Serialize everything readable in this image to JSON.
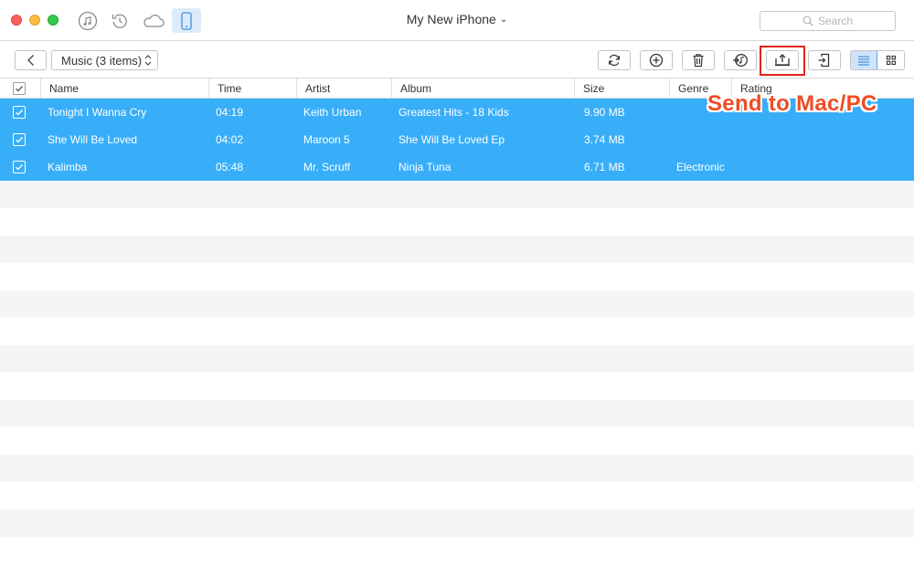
{
  "window": {
    "device_title": "My New iPhone",
    "modes": [
      {
        "icon": "music-note-icon",
        "active": false
      },
      {
        "icon": "restore-icon",
        "active": false
      },
      {
        "icon": "cloud-icon",
        "active": false
      },
      {
        "icon": "iphone-icon",
        "active": true
      }
    ]
  },
  "search": {
    "placeholder": "Search",
    "icon": "search-icon"
  },
  "toolbar": {
    "category_label": "Music (3 items)",
    "buttons": [
      {
        "icon": "refresh-icon"
      },
      {
        "icon": "add-icon"
      },
      {
        "icon": "trash-icon"
      },
      {
        "icon": "send-to-itunes-icon"
      },
      {
        "icon": "send-to-computer-icon"
      },
      {
        "icon": "send-to-device-icon"
      }
    ],
    "views": [
      {
        "icon": "list-view-icon",
        "active": true
      },
      {
        "icon": "grid-view-icon",
        "active": false
      }
    ]
  },
  "annotation": {
    "text": "Send to Mac/PC",
    "color": "#ef4c24"
  },
  "table": {
    "columns": [
      "Name",
      "Time",
      "Artist",
      "Album",
      "Size",
      "Genre",
      "Rating"
    ],
    "rows": [
      {
        "name": "Tonight I Wanna Cry",
        "time": "04:19",
        "artist": "Keith Urban",
        "album": "Greatest Hits - 18 Kids",
        "size": "9.90 MB",
        "genre": "",
        "rating": "",
        "checked": true
      },
      {
        "name": "She Will Be Loved",
        "time": "04:02",
        "artist": "Maroon 5",
        "album": "She Will Be Loved Ep",
        "size": "3.74 MB",
        "genre": "",
        "rating": "",
        "checked": true
      },
      {
        "name": "Kalimba",
        "time": "05:48",
        "artist": "Mr. Scruff",
        "album": "Ninja Tuna",
        "size": "6.71 MB",
        "genre": "Electronic",
        "rating": "",
        "checked": true
      }
    ]
  },
  "colors": {
    "selection": "#38aef9",
    "stripe": "#f5f5f5",
    "highlight_box": "#e2251b",
    "active_mode": "#dcebf9"
  }
}
